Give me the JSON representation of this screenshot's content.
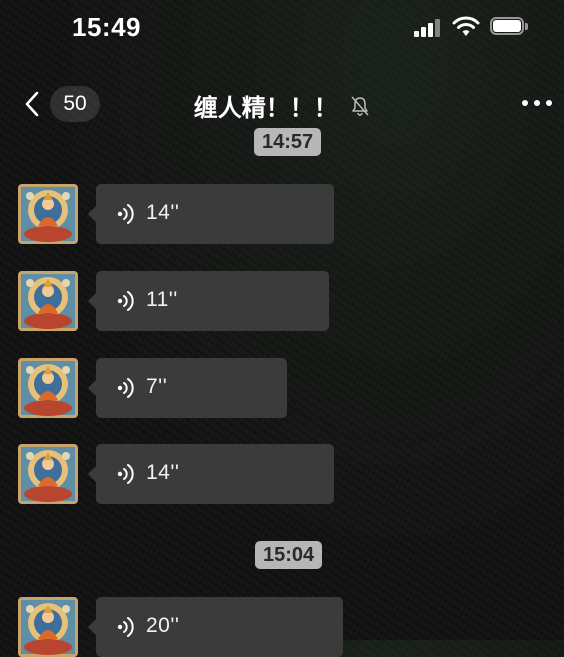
{
  "status_bar": {
    "time": "15:49"
  },
  "nav": {
    "unread_count": "50",
    "title": "缠人精！！！"
  },
  "time_dividers": [
    "14:57",
    "15:04"
  ],
  "messages": [
    {
      "type": "voice",
      "duration": "14''"
    },
    {
      "type": "voice",
      "duration": "11''"
    },
    {
      "type": "voice",
      "duration": "7''"
    },
    {
      "type": "voice",
      "duration": "14''"
    },
    {
      "type": "voice",
      "duration": "20''"
    }
  ],
  "colors": {
    "background": "#141414",
    "bubble": "#3b3b3b",
    "time_divider_bg": "#cdcdcd"
  },
  "icons": {
    "back": "chevron-left-icon",
    "mute": "bell-slash-icon",
    "more": "ellipsis-icon",
    "voice": "voice-wave-icon",
    "signal": "cellular-signal-icon",
    "wifi": "wifi-icon",
    "battery": "battery-icon"
  }
}
